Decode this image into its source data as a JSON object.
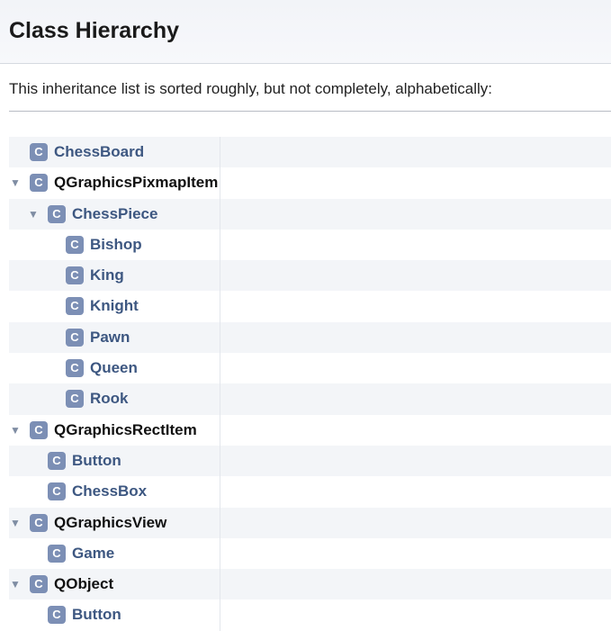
{
  "header": {
    "title": "Class Hierarchy"
  },
  "intro": "This inheritance list is sorted roughly, but not completely, alphabetically:",
  "class_badge": "C",
  "expand_icon": "▼",
  "tree": [
    {
      "label": "ChessBoard",
      "level": 0,
      "expandable": false,
      "external": false
    },
    {
      "label": "QGraphicsPixmapItem",
      "level": 0,
      "expandable": true,
      "external": true
    },
    {
      "label": "ChessPiece",
      "level": 1,
      "expandable": true,
      "external": false
    },
    {
      "label": "Bishop",
      "level": 2,
      "expandable": false,
      "external": false
    },
    {
      "label": "King",
      "level": 2,
      "expandable": false,
      "external": false
    },
    {
      "label": "Knight",
      "level": 2,
      "expandable": false,
      "external": false
    },
    {
      "label": "Pawn",
      "level": 2,
      "expandable": false,
      "external": false
    },
    {
      "label": "Queen",
      "level": 2,
      "expandable": false,
      "external": false
    },
    {
      "label": "Rook",
      "level": 2,
      "expandable": false,
      "external": false
    },
    {
      "label": "QGraphicsRectItem",
      "level": 0,
      "expandable": true,
      "external": true
    },
    {
      "label": "Button",
      "level": 1,
      "expandable": false,
      "external": false
    },
    {
      "label": "ChessBox",
      "level": 1,
      "expandable": false,
      "external": false
    },
    {
      "label": "QGraphicsView",
      "level": 0,
      "expandable": true,
      "external": true
    },
    {
      "label": "Game",
      "level": 1,
      "expandable": false,
      "external": false
    },
    {
      "label": "QObject",
      "level": 0,
      "expandable": true,
      "external": true
    },
    {
      "label": "Button",
      "level": 1,
      "expandable": false,
      "external": false
    }
  ]
}
